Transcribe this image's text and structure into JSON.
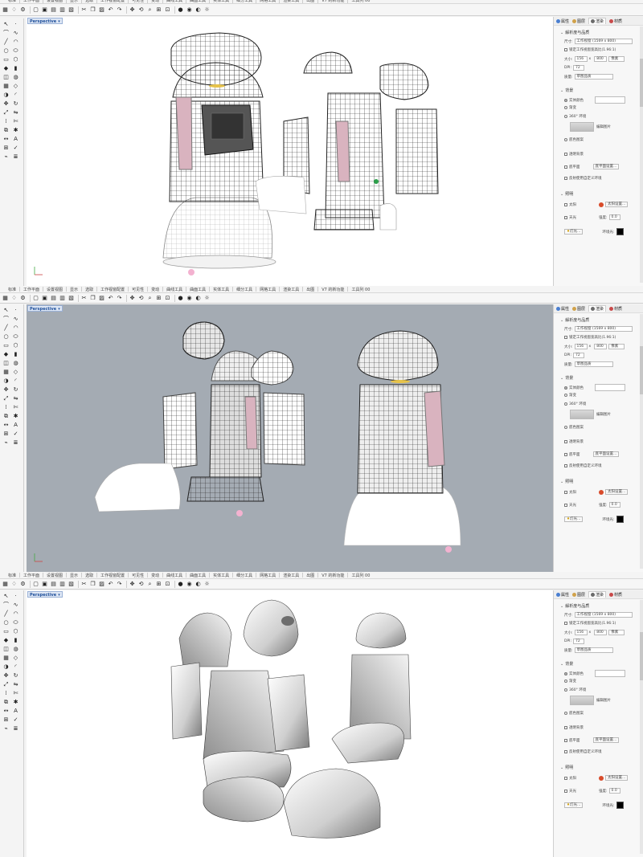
{
  "tabs": [
    "标准",
    "工作平面",
    "设置视图",
    "显示",
    "选取",
    "工作视窗配置",
    "可见性",
    "变动",
    "曲线工具",
    "曲面工具",
    "实体工具",
    "细分工具",
    "网格工具",
    "渲染工具",
    "出图",
    "V7 的新功能",
    "工具列 00"
  ],
  "viewport": {
    "label": "Perspective",
    "dropdown": "▾"
  },
  "panel": {
    "tabs": [
      "属性",
      "图层",
      "渲染",
      "材质"
    ],
    "section_render": "解析度与品质",
    "size_label": "尺寸:",
    "size_value": "工作视窗 (1569 x 800)",
    "lock_label": "锁定工作视窗宽高比(1.96:1)",
    "width_label": "大小:",
    "width_value": "156",
    "x": "x",
    "height_value": "800",
    "unit": "像素",
    "dpi_label": "DPI:",
    "dpi_value": "72",
    "quality_label": "质量:",
    "quality_value": "草图品质",
    "section_bg": "背景",
    "bg_solid": "实体颜色",
    "bg_gradient": "渐变",
    "bg_360": "360° 环境",
    "bg_image": "底色图案",
    "bg_thumb_label": "编辑图片",
    "transparent": "透明背景",
    "ground": "底平面",
    "ground_btn": "底平面设置...",
    "custom_env": "反射使用自定义环境",
    "section_light": "照明",
    "sun": "太阳",
    "sun_btn": "太阳设置...",
    "skylight": "天光",
    "intensity_label": "强度:",
    "intensity_value": "0.0",
    "lights_btn": "灯光...",
    "env_label": "环境光:"
  },
  "frames": [
    {
      "mode": "wireframe"
    },
    {
      "mode": "wireframe-gray"
    },
    {
      "mode": "shaded"
    }
  ],
  "colors": {
    "viewport_gray": "#a4abb3",
    "label_blue": "#1d4e9a",
    "pink_part": "#d9b3bf"
  }
}
